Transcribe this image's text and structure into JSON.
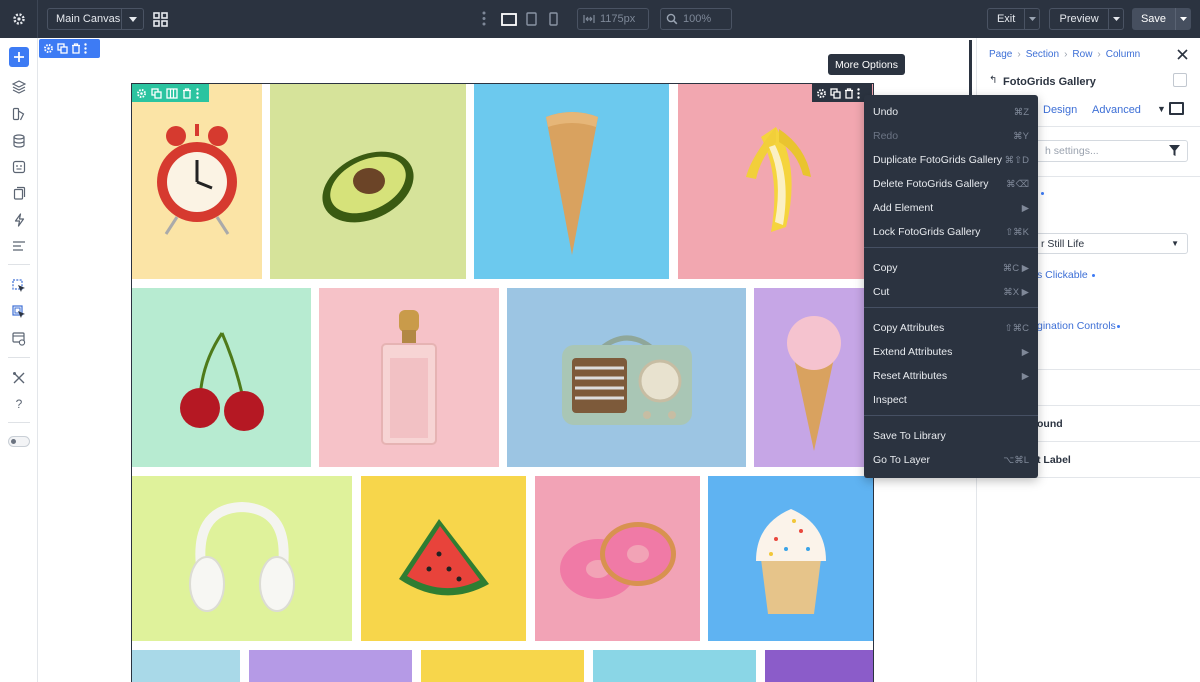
{
  "topbar": {
    "canvas_select": "Main Canvas",
    "width_value": "1175px",
    "zoom_value": "100%",
    "exit_label": "Exit",
    "preview_label": "Preview",
    "save_label": "Save"
  },
  "canvas": {
    "tooltip": "More Options",
    "gallery_tiles": [
      {
        "name": "alarm-clock",
        "bg": "#fbe4a6"
      },
      {
        "name": "avocado",
        "bg": "#d6e39a"
      },
      {
        "name": "ice-cream-cone",
        "bg": "#6cc9ee"
      },
      {
        "name": "banana",
        "bg": "#f2a7b0"
      },
      {
        "name": "cherries",
        "bg": "#b7ebd1"
      },
      {
        "name": "perfume-bottle",
        "bg": "#f6c2c8"
      },
      {
        "name": "vintage-radio",
        "bg": "#9cc5e3"
      },
      {
        "name": "ice-cream-scoop",
        "bg": "#c6a6e6"
      },
      {
        "name": "headphones",
        "bg": "#dff29b"
      },
      {
        "name": "watermelon-slice",
        "bg": "#f7d64b"
      },
      {
        "name": "donuts",
        "bg": "#f2a3b6"
      },
      {
        "name": "cupcake",
        "bg": "#5fb3f2"
      },
      {
        "name": "row4-tile-1",
        "bg": "#a9d9e8"
      },
      {
        "name": "row4-tile-2",
        "bg": "#b59ae6"
      },
      {
        "name": "row4-tile-3",
        "bg": "#f7d64b"
      },
      {
        "name": "row4-tile-4",
        "bg": "#8ad6e6"
      },
      {
        "name": "row4-tile-5",
        "bg": "#8b5cc9"
      }
    ]
  },
  "context_menu": {
    "items": [
      {
        "label": "Undo",
        "shortcut": "⌘Z"
      },
      {
        "label": "Redo",
        "shortcut": "⌘Y"
      },
      {
        "label": "Duplicate FotoGrids Gallery",
        "shortcut": "⌘⇧D"
      },
      {
        "label": "Delete FotoGrids Gallery",
        "shortcut": "⌘⌫"
      },
      {
        "label": "Add Element",
        "shortcut": "▶"
      },
      {
        "label": "Lock FotoGrids Gallery",
        "shortcut": "⇧⌘K"
      },
      {
        "label": "Copy",
        "shortcut": "⌘C ▶"
      },
      {
        "label": "Cut",
        "shortcut": "⌘X ▶"
      },
      {
        "label": "Copy Attributes",
        "shortcut": "⇧⌘C"
      },
      {
        "label": "Extend Attributes",
        "shortcut": "▶"
      },
      {
        "label": "Reset Attributes",
        "shortcut": "▶"
      },
      {
        "label": "Inspect",
        "shortcut": ""
      },
      {
        "label": "Save To Library",
        "shortcut": ""
      },
      {
        "label": "Go To Layer",
        "shortcut": "⌥⌘L"
      }
    ]
  },
  "panel": {
    "breadcrumb": [
      "Page",
      "Section",
      "Row",
      "Column"
    ],
    "title": "FotoGrids Gallery",
    "tabs": [
      "Design",
      "Advanced"
    ],
    "search_placeholder": "h settings...",
    "select_value": "r Still Life",
    "clickable_label": "s Clickable",
    "pagination_label": "gination Controls",
    "background_label": "ound",
    "label_label": "t Label"
  },
  "colors": {
    "chrome_dark": "#2b3340",
    "accent_blue": "#3d7bf4",
    "row_green": "#2bc4a0",
    "link_blue": "#3d6fd6"
  }
}
